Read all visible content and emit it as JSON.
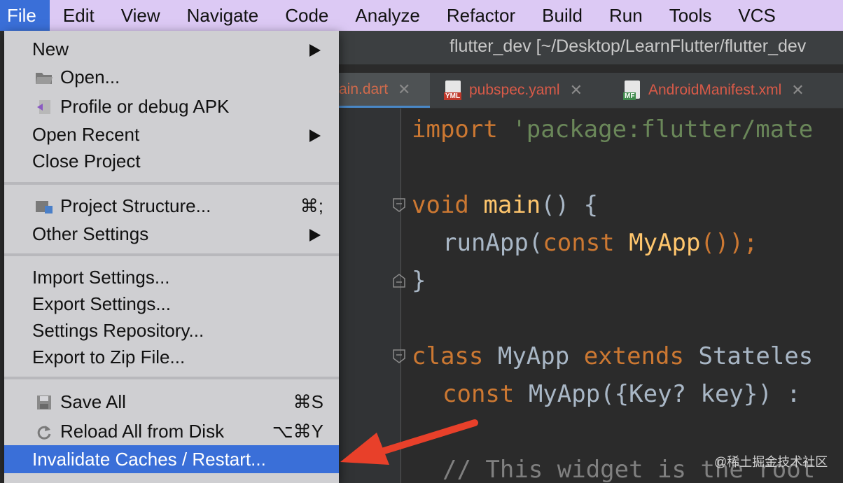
{
  "menubar": {
    "items": [
      "File",
      "Edit",
      "View",
      "Navigate",
      "Code",
      "Analyze",
      "Refactor",
      "Build",
      "Run",
      "Tools",
      "VCS"
    ]
  },
  "window": {
    "title": "flutter_dev [~/Desktop/LearnFlutter/flutter_dev"
  },
  "tabs": [
    {
      "label": "ain.dart",
      "icon": "dart-file-icon"
    },
    {
      "label": "pubspec.yaml",
      "icon": "yaml-file-icon",
      "badge": "YML"
    },
    {
      "label": "AndroidManifest.xml",
      "icon": "manifest-file-icon",
      "badge": "MF"
    }
  ],
  "code": {
    "line1": {
      "kw": "import",
      "str": "'package:flutter/mate"
    },
    "line2": {
      "kw": "void",
      "fn": "main",
      "rest": "() {"
    },
    "line3": {
      "plain": "runApp(",
      "kw": "const",
      "fn": "MyApp",
      "rest": "());"
    },
    "line4": {
      "plain": "}"
    },
    "line5": {
      "kw1": "class",
      "mid1": "MyApp",
      "kw2": "extends",
      "mid2": "Stateles"
    },
    "line6": {
      "kw": "const",
      "fn": "MyApp",
      "rest": "({Key? key}) :"
    },
    "line7": {
      "cm": "// This widget is the root"
    }
  },
  "file_menu": {
    "new": "New",
    "open": "Open...",
    "profile_apk": "Profile or debug APK",
    "open_recent": "Open Recent",
    "close_project": "Close Project",
    "project_structure": "Project Structure...",
    "project_structure_shortcut": "⌘;",
    "other_settings": "Other Settings",
    "import_settings": "Import Settings...",
    "export_settings": "Export Settings...",
    "settings_repository": "Settings Repository...",
    "export_zip": "Export to Zip File...",
    "save_all": "Save All",
    "save_all_shortcut": "⌘S",
    "reload_all": "Reload All from Disk",
    "reload_all_shortcut": "⌥⌘Y",
    "invalidate": "Invalidate Caches / Restart..."
  },
  "watermark": "@稀土掘金技术社区",
  "colors": {
    "menubar_bg": "#dcc9f4",
    "highlight": "#3a6fd8",
    "annotation_arrow": "#e8402a",
    "keyword": "#cc7832",
    "string": "#6a8759",
    "function": "#ffc66d"
  }
}
